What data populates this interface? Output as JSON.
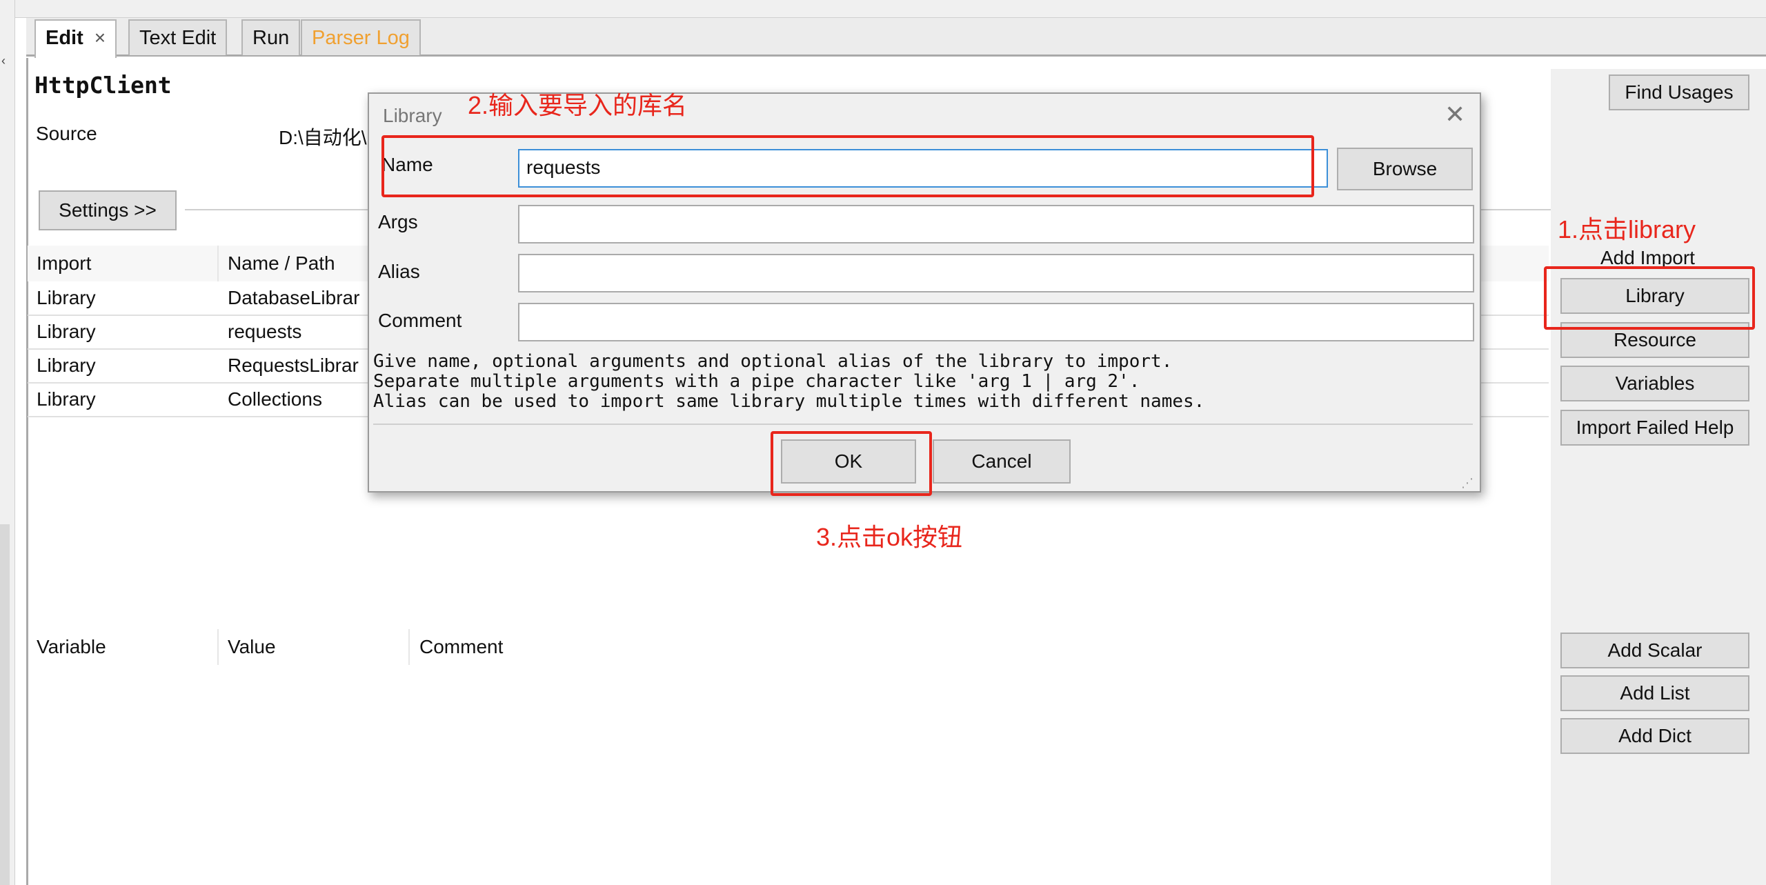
{
  "tabs": [
    {
      "label": "Edit",
      "close": "×",
      "active": true
    },
    {
      "label": "Text Edit"
    },
    {
      "label": "Run"
    },
    {
      "label": "Parser Log"
    }
  ],
  "page": {
    "title": "HttpClient",
    "source_label": "Source",
    "source_value": "D:\\自动化\\",
    "settings_button": "Settings >>",
    "find_usages_button": "Find Usages"
  },
  "imports": {
    "headers": [
      "Import",
      "Name / Path"
    ],
    "rows": [
      {
        "type": "Library",
        "name": "DatabaseLibrar"
      },
      {
        "type": "Library",
        "name": "requests"
      },
      {
        "type": "Library",
        "name": "RequestsLibrar"
      },
      {
        "type": "Library",
        "name": "Collections"
      }
    ]
  },
  "add_import": {
    "label": "Add Import",
    "buttons": [
      "Library",
      "Resource",
      "Variables",
      "Import Failed Help"
    ]
  },
  "variables": {
    "headers": [
      "Variable",
      "Value",
      "Comment"
    ],
    "buttons": [
      "Add Scalar",
      "Add List",
      "Add Dict"
    ]
  },
  "dialog": {
    "title": "Library",
    "close": "✕",
    "name_label": "Name",
    "name_value": "requests",
    "browse_button": "Browse",
    "args_label": "Args",
    "alias_label": "Alias",
    "comment_label": "Comment",
    "help_text": "Give name, optional arguments and optional alias of the library to import.\nSeparate multiple arguments with a pipe character like 'arg 1 | arg 2'.\nAlias can be used to import same library multiple times with different names.",
    "ok_button": "OK",
    "cancel_button": "Cancel"
  },
  "annotations": {
    "step1": "1.点击library",
    "step2": "2.输入要导入的库名",
    "step3": "3.点击ok按钮",
    "color": "#e8261c"
  },
  "colors": {
    "parser_log_tab": "#f0a030",
    "focus_border": "#3c8fd8"
  }
}
